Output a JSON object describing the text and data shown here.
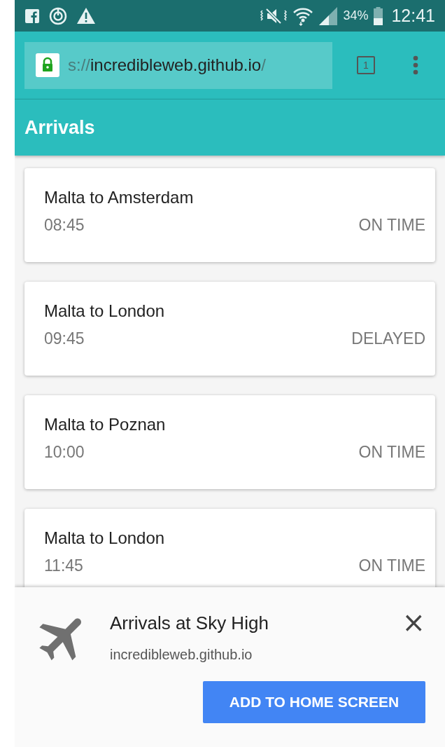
{
  "status_bar": {
    "battery_percent": "34%",
    "time": "12:41"
  },
  "browser": {
    "url_scheme_part": "s://",
    "url_host": "incredibleweb.github.io",
    "url_rest": "/",
    "tab_count": "1"
  },
  "header": {
    "title": "Arrivals"
  },
  "flights": [
    {
      "route": "Malta to Amsterdam",
      "time": "08:45",
      "status": "ON TIME"
    },
    {
      "route": "Malta to London",
      "time": "09:45",
      "status": "DELAYED"
    },
    {
      "route": "Malta to Poznan",
      "time": "10:00",
      "status": "ON TIME"
    },
    {
      "route": "Malta to London",
      "time": "11:45",
      "status": "ON TIME"
    }
  ],
  "install_banner": {
    "title": "Arrivals at Sky High",
    "site": "incredibleweb.github.io",
    "close": "×",
    "button": "ADD TO HOME SCREEN"
  }
}
